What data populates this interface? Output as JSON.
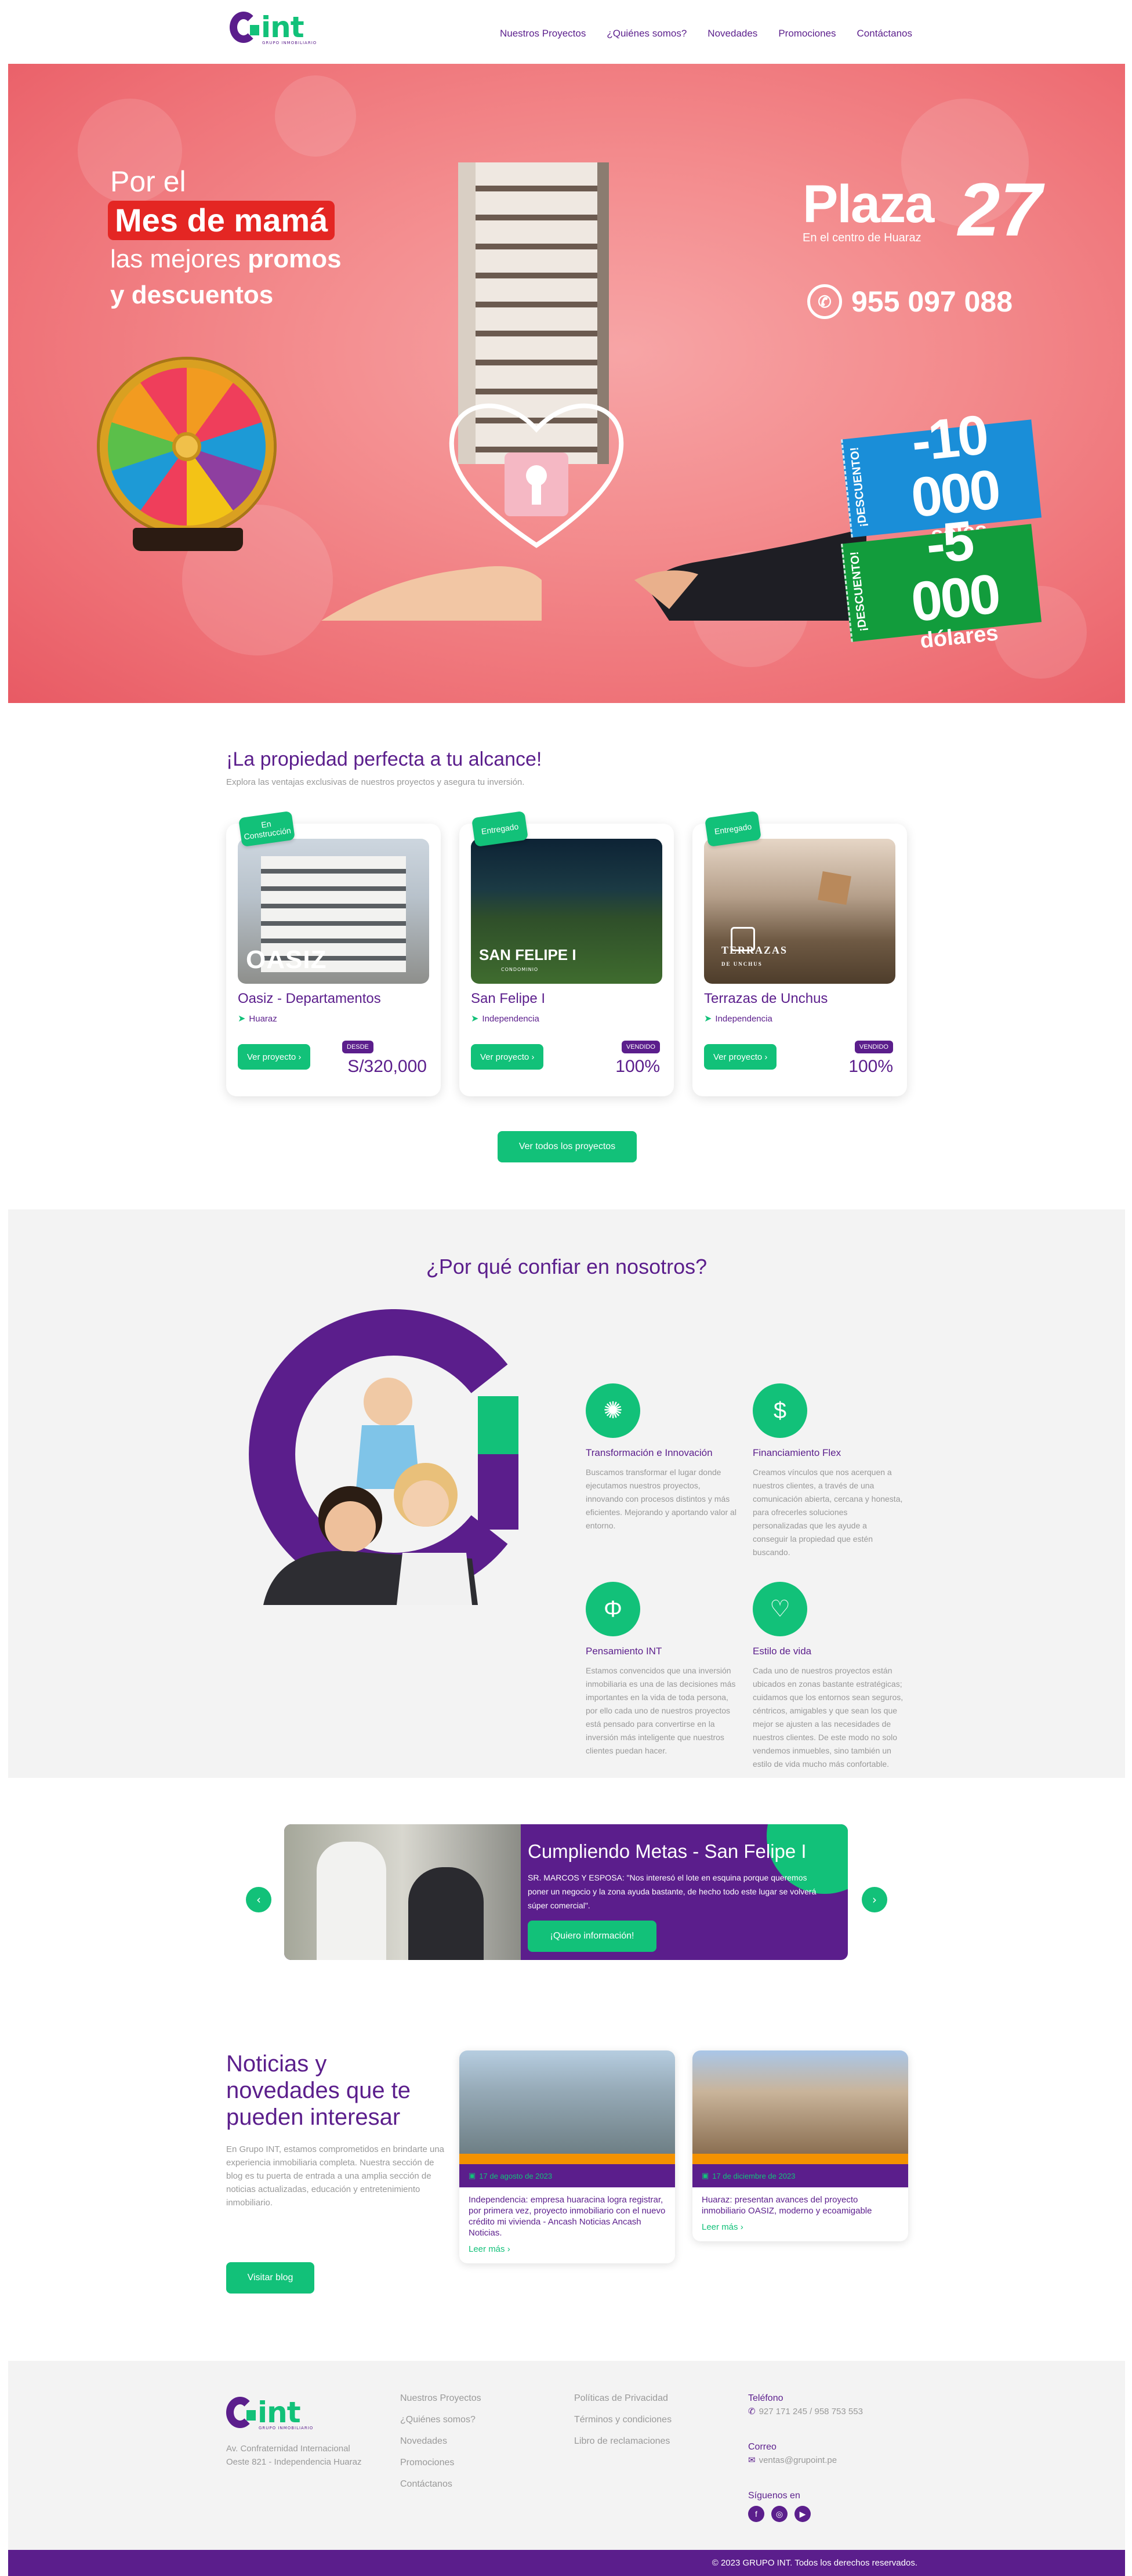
{
  "brand": {
    "logo_text": "int",
    "logo_sub": "GRUPO INMOBILIARIO",
    "primary_color": "#5b1e8c",
    "accent_color": "#12c179"
  },
  "nav": {
    "items": [
      "Nuestros Proyectos",
      "¿Quiénes somos?",
      "Novedades",
      "Promociones",
      "Contáctanos"
    ]
  },
  "hero": {
    "line1": "Por el",
    "line2": "Mes de mamá",
    "line3_a": "las mejores ",
    "line3_b": "promos",
    "line4": "y descuentos",
    "plaza_name": "Plaza",
    "plaza_number": "27",
    "plaza_tag": "En el centro de Huaraz",
    "phone": "955 097 088",
    "ticket1_side": "¡DESCUENTO!",
    "ticket1_amount": "-10 000",
    "ticket1_unit": "soles",
    "ticket2_side": "¡DESCUENTO!",
    "ticket2_amount": "-5 000",
    "ticket2_unit": "dólares"
  },
  "properties": {
    "title": "¡La propiedad perfecta a tu alcance!",
    "subtitle": "Explora las ventajas exclusivas de nuestros proyectos y asegura tu inversión.",
    "cards": [
      {
        "flag": "En Construcción",
        "image_label": "OASIZ",
        "name": "Oasiz - Departamentos",
        "location": "Huaraz",
        "button": "Ver proyecto ›",
        "badge": "DESDE",
        "price": "S/320,000"
      },
      {
        "flag": "Entregado",
        "image_label": "SAN FELIPE I",
        "image_sub": "CONDOMINIO",
        "name": "San Felipe I",
        "location": "Independencia",
        "button": "Ver proyecto ›",
        "badge": "VENDIDO",
        "price": "100%"
      },
      {
        "flag": "Entregado",
        "image_label": "TERRAZAS",
        "image_sub": "DE UNCHUS",
        "name": "Terrazas de Unchus",
        "location": "Independencia",
        "button": "Ver proyecto ›",
        "badge": "VENDIDO",
        "price": "100%"
      }
    ],
    "all_button": "Ver todos los proyectos"
  },
  "trust": {
    "title": "¿Por qué confiar en nosotros?",
    "features": [
      {
        "icon": "lightbulb-icon",
        "title": "Transformación e Innovación",
        "text": "Buscamos transformar el lugar donde ejecutamos nuestros proyectos, innovando con procesos distintos y más eficientes. Mejorando y aportando valor al entorno."
      },
      {
        "icon": "money-icon",
        "title": "Financiamiento Flex",
        "text": "Creamos vínculos que nos acerquen a nuestros clientes, a través de una comunicación abierta, cercana y honesta, para ofrecerles soluciones personalizadas que les ayude a conseguir la propiedad que estén buscando."
      },
      {
        "icon": "brain-icon",
        "title": "Pensamiento INT",
        "text": "Estamos convencidos que una inversión inmobiliaria es una de las decisiones más importantes en la vida de toda persona, por ello cada uno de nuestros proyectos está pensado para convertirse en la inversión más inteligente que nuestros clientes puedan hacer."
      },
      {
        "icon": "heart-pulse-icon",
        "title": "Estilo de vida",
        "text": "Cada uno de nuestros proyectos están ubicados en zonas bastante estratégicas; cuidamos que los entornos sean seguros, céntricos, amigables y que sean los que mejor se ajusten a las necesidades de nuestros clientes. De este modo no solo vendemos inmuebles, sino también un estilo de vida mucho más confortable."
      }
    ]
  },
  "testimonial": {
    "title": "Cumpliendo Metas - San Felipe I",
    "quote": "SR. MARCOS Y ESPOSA: \"Nos interesó el lote en esquina porque queremos poner un negocio y la zona ayuda bastante, de hecho todo este lugar se volverá súper comercial\".",
    "cta": "¡Quiero información!"
  },
  "news": {
    "title": "Noticias y novedades que te pueden interesar",
    "text": "En Grupo INT, estamos comprometidos en brindarte una experiencia inmobiliaria completa. Nuestra sección de blog es tu puerta de entrada a una amplia sección de noticias actualizadas, educación y entretenimiento inmobiliario.",
    "blog_button": "Visitar blog",
    "items": [
      {
        "date": "17 de agosto de 2023",
        "title": "Independencia: empresa huaracina logra registrar, por primera vez, proyecto inmobiliario con el nuevo crédito mi vivienda - Ancash Noticias Ancash Noticias.",
        "more": "Leer más ›"
      },
      {
        "date": "17 de diciembre de 2023",
        "title": "Huaraz: presentan avances del proyecto inmobiliario OASIZ, moderno y ecoamigable",
        "more": "Leer más ›"
      }
    ]
  },
  "footer": {
    "address": "Av. Confraternidad Internacional Oeste 821 - Independencia Huaraz",
    "col1": [
      "Nuestros Proyectos",
      "¿Quiénes somos?",
      "Novedades",
      "Promociones",
      "Contáctanos"
    ],
    "col2": [
      "Políticas de Privacidad",
      "Términos y condiciones",
      "Libro de reclamaciones"
    ],
    "phone_label": "Teléfono",
    "phone": "927 171 245 / 958 753 553",
    "email_label": "Correo",
    "email": "ventas@grupoint.pe",
    "social_label": "Síguenos en",
    "copyright": "© 2023 GRUPO INT. Todos los derechos reservados."
  }
}
